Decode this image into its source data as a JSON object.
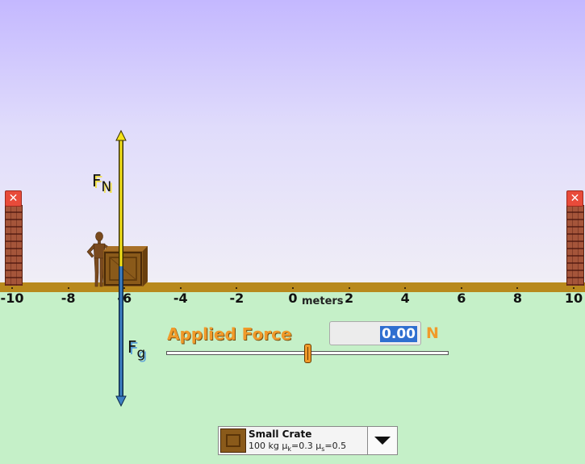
{
  "axis": {
    "ticks": [
      "-10",
      "-8",
      "-6",
      "-4",
      "-2",
      "0",
      "2",
      "4",
      "6",
      "8",
      "10"
    ],
    "units": "meters"
  },
  "forces": {
    "normal": {
      "symbol": "F",
      "subscript": "N"
    },
    "gravity": {
      "symbol": "F",
      "subscript": "g"
    }
  },
  "controls": {
    "applied_force_label": "Applied Force",
    "applied_force_value": "0.00",
    "applied_force_unit": "N",
    "slider_level_fraction": 0.5
  },
  "object_selector": {
    "name": "Small Crate",
    "mass": "100 kg",
    "mu_k": "μ",
    "mu_k_sub": "k",
    "mu_k_val": "=0.3",
    "mu_s": "μ",
    "mu_s_sub": "s",
    "mu_s_val": "=0.5"
  },
  "icons": {
    "wall_remove": "close-icon",
    "dropdown": "chevron-down-icon"
  },
  "colors": {
    "normal_force": "#f5e31a",
    "gravity_force": "#3d7fc4",
    "applied_label": "#f09a2a",
    "ground": "#b8891d"
  }
}
